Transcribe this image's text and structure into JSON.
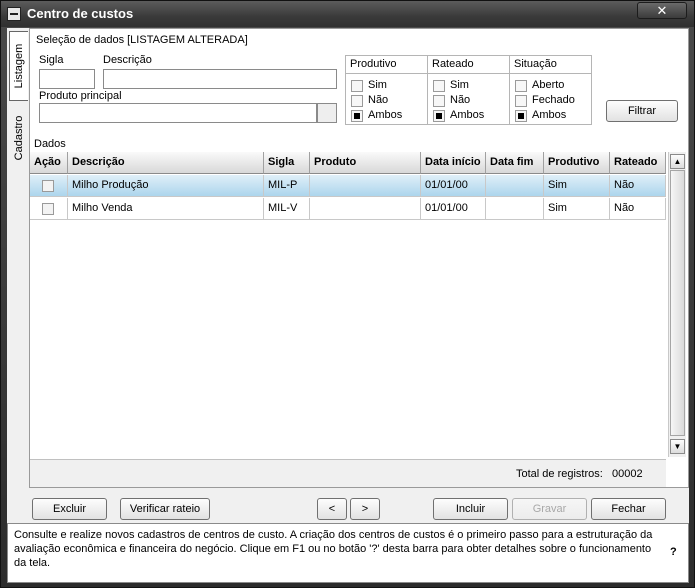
{
  "window": {
    "title": "Centro de custos",
    "close_glyph": "✕"
  },
  "side_tabs": [
    {
      "label": "Listagem",
      "active": true
    },
    {
      "label": "Cadastro",
      "active": false
    }
  ],
  "filters": {
    "section_title": "Seleção de dados [LISTAGEM ALTERADA]",
    "sigla_label": "Sigla",
    "sigla_value": "",
    "descricao_label": "Descrição",
    "descricao_value": "",
    "produto_label": "Produto principal",
    "produto_value": "",
    "groups": [
      {
        "title": "Produtivo",
        "options": [
          {
            "label": "Sim",
            "checked": false
          },
          {
            "label": "Não",
            "checked": false
          },
          {
            "label": "Ambos",
            "checked": true
          }
        ]
      },
      {
        "title": "Rateado",
        "options": [
          {
            "label": "Sim",
            "checked": false
          },
          {
            "label": "Não",
            "checked": false
          },
          {
            "label": "Ambos",
            "checked": true
          }
        ]
      },
      {
        "title": "Situação",
        "options": [
          {
            "label": "Aberto",
            "checked": false
          },
          {
            "label": "Fechado",
            "checked": false
          },
          {
            "label": "Ambos",
            "checked": true
          }
        ]
      }
    ],
    "filter_button": "Filtrar"
  },
  "data": {
    "section_title": "Dados",
    "columns": [
      "Ação",
      "Descrição",
      "Sigla",
      "Produto",
      "Data início",
      "Data fim",
      "Produtivo",
      "Rateado"
    ],
    "rows": [
      {
        "descricao": "Milho Produção",
        "sigla": "MIL-P",
        "produto": "",
        "data_inicio": "01/01/00",
        "data_fim": "",
        "produtivo": "Sim",
        "rateado": "Não",
        "selected": true
      },
      {
        "descricao": "Milho Venda",
        "sigla": "MIL-V",
        "produto": "",
        "data_inicio": "01/01/00",
        "data_fim": "",
        "produtivo": "Sim",
        "rateado": "Não",
        "selected": false
      }
    ],
    "total_label": "Total de registros:",
    "total_value": "00002"
  },
  "buttons": {
    "excluir": "Excluir",
    "verificar": "Verificar rateio",
    "prev": "<",
    "next": ">",
    "incluir": "Incluir",
    "gravar": "Gravar",
    "fechar": "Fechar"
  },
  "help": {
    "text": "Consulte e realize novos cadastros de centros de custo. A criação dos centros de custos é o primeiro passo para a estruturação da avaliação econômica e financeira do negócio. Clique em F1 ou no botão '?' desta barra para obter detalhes sobre o funcionamento da tela.",
    "question": "?"
  },
  "colors": {
    "selected_row": "#aad4ec",
    "titlebar": "#3a3a3a"
  }
}
